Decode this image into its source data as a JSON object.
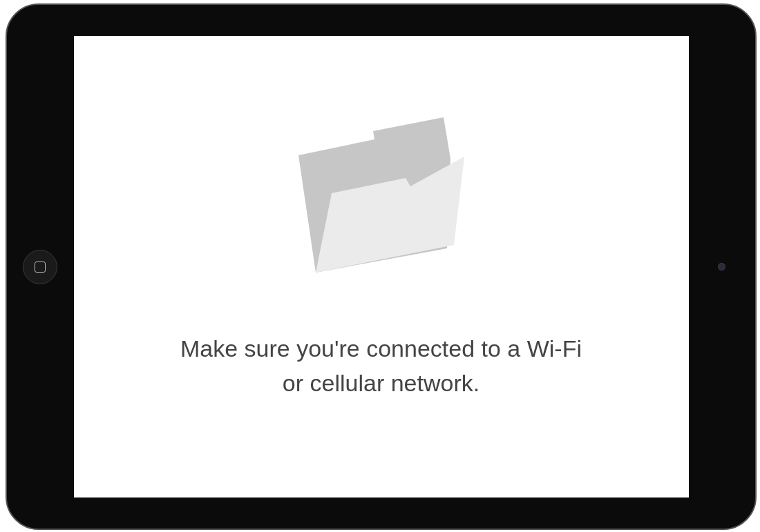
{
  "message": "Make sure you're connected to a Wi-Fi or cellular network."
}
